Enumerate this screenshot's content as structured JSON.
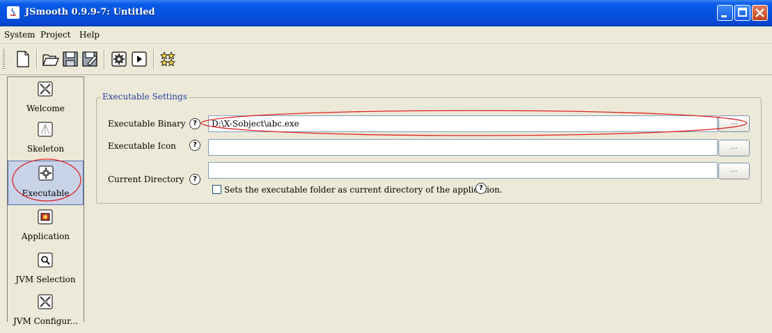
{
  "window": {
    "title": "JSmooth 0.9.9-7: Untitled"
  },
  "menu": [
    "System",
    "Project",
    "Help"
  ],
  "toolbar": {
    "buttons": [
      "new-document-icon",
      "open-folder-icon",
      "save-icon",
      "save-as-icon",
      "compile-gear-icon",
      "run-icon",
      "skeleton-stars-icon"
    ]
  },
  "sidebar": {
    "items": [
      {
        "label": "Welcome",
        "icon": "welcome-icon"
      },
      {
        "label": "Skeleton",
        "icon": "skeleton-icon"
      },
      {
        "label": "Executable",
        "icon": "executable-gear-icon",
        "selected": true
      },
      {
        "label": "Application",
        "icon": "application-icon"
      },
      {
        "label": "JVM Selection",
        "icon": "jvm-selection-icon"
      },
      {
        "label": "JVM Configur...",
        "icon": "jvm-configuration-icon"
      }
    ]
  },
  "settings": {
    "legend": "Executable Settings",
    "binary_label": "Executable Binary",
    "binary_value": "D:\\X-Sobject\\abc.exe",
    "icon_label": "Executable Icon",
    "icon_value": "",
    "dir_label": "Current Directory",
    "dir_value": "",
    "checkbox_label": "Sets the executable folder as current directory of the application.",
    "checkbox_checked": false,
    "browse_label": "...",
    "help_glyph": "?"
  },
  "colors": {
    "titlebar": "#0553E0",
    "background": "#ECE9D8",
    "legend": "#1E3EA0",
    "annotation": "#E02020"
  }
}
